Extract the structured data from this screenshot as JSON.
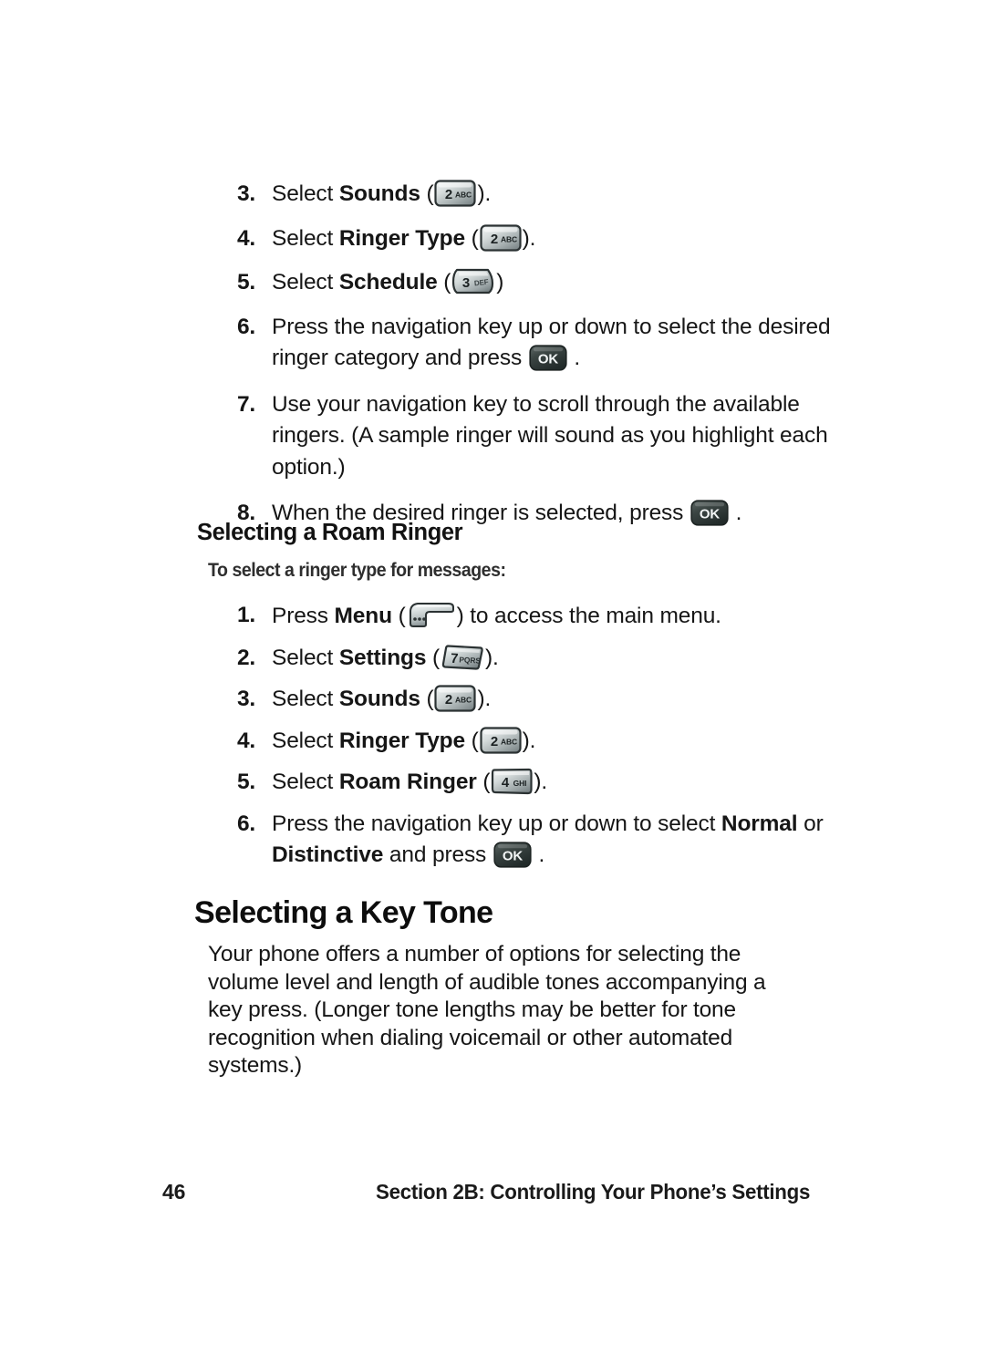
{
  "document": {
    "type": "phone-user-guide-page",
    "page_number": "46",
    "footer_title": "Section 2B: Controlling Your Phone’s Settings"
  },
  "steps_ringer_schedule": [
    {
      "num": "3.",
      "prefix": "Select ",
      "bold": "Sounds",
      "open": " (",
      "key": "key-2-abc",
      "close": ").",
      "lines": 1
    },
    {
      "num": "4.",
      "prefix": "Select ",
      "bold": "Ringer Type",
      "open": " (",
      "key": "key-2-abc",
      "close": ").",
      "lines": 1
    },
    {
      "num": "5.",
      "prefix": "Select ",
      "bold": "Schedule",
      "open": " (",
      "key": "key-3-def",
      "close": ")",
      "lines": 1
    },
    {
      "num": "6.",
      "text_a": "Press the navigation key up or down to select the desired ringer category and press ",
      "key": "key-ok",
      "text_b": " ."
    },
    {
      "num": "7.",
      "text_a": "Use your navigation key to scroll through the available ringers. (A sample ringer will sound as you highlight each option.)"
    },
    {
      "num": "8.",
      "text_a": "When the desired ringer is selected, press ",
      "key": "key-ok",
      "text_b": " ."
    }
  ],
  "roam_ringer": {
    "heading": "Selecting a Roam Ringer",
    "lead_in": "To select a ringer type for messages:",
    "steps": [
      {
        "num": "1.",
        "prefix": "Press ",
        "bold": "Menu",
        "open": " (",
        "key": "key-menu-soft",
        "close": ") to access the main menu."
      },
      {
        "num": "2.",
        "prefix": "Select ",
        "bold": "Settings",
        "open": " (",
        "key": "key-7-pqrs",
        "close": ")."
      },
      {
        "num": "3.",
        "prefix": "Select ",
        "bold": "Sounds",
        "open": " (",
        "key": "key-2-abc",
        "close": ")."
      },
      {
        "num": "4.",
        "prefix": "Select ",
        "bold": "Ringer Type",
        "open": " (",
        "key": "key-2-abc",
        "close": ")."
      },
      {
        "num": "5.",
        "prefix": "Select ",
        "bold": "Roam Ringer",
        "open": " (",
        "key": "key-4-ghi",
        "close": ")."
      },
      {
        "num": "6.",
        "text_a": "Press the navigation key up or down to select ",
        "bold_a": "Normal",
        "text_b": " or ",
        "bold_b": "Distinctive",
        "text_c": " and press ",
        "key": "key-ok",
        "text_d": " ."
      }
    ]
  },
  "key_tone": {
    "heading": "Selecting a Key Tone",
    "paragraph": "Your phone offers a number of options for selecting the volume level and length of audible tones accompanying a key press. (Longer tone lengths may be better for tone recognition when dialing voicemail or other automated systems.)"
  },
  "key_icons": {
    "key-2-abc": {
      "digit": "2",
      "letters": "ABC",
      "shape": "rounded-rect"
    },
    "key-3-def": {
      "digit": "3",
      "letters": "DEF",
      "shape": "tapered-right"
    },
    "key-4-ghi": {
      "digit": "4",
      "letters": "GHI",
      "shape": "rounded-rect"
    },
    "key-7-pqrs": {
      "digit": "7",
      "letters": "PQRS",
      "shape": "slanted-parallelogram"
    },
    "key-ok": {
      "label": "OK",
      "shape": "dark-rounded-rect"
    },
    "key-menu-soft": {
      "label": "",
      "shape": "hook-softkey-with-dots"
    }
  },
  "colors": {
    "text": "#161616",
    "heading": "#0d0d0d",
    "lead_in": "#2e2e2e",
    "key_light": "#e9ecec",
    "key_mid": "#b9c0c1",
    "key_dark": "#6f7a7a",
    "key_outline": "#2a3030",
    "ok_key_bg": "#343c3a",
    "page_bg": "#ffffff"
  }
}
